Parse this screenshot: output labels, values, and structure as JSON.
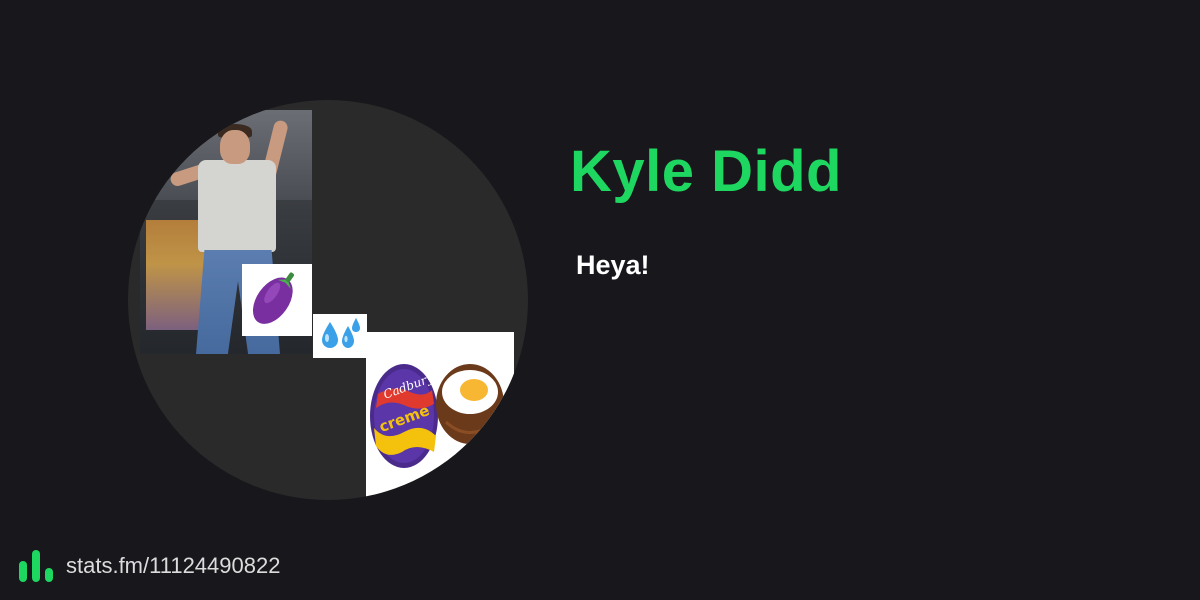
{
  "profile": {
    "display_name": "Kyle Didd",
    "bio": "Heya!",
    "avatar": {
      "tiles": [
        "photo",
        "eggplant-emoji",
        "sweat-droplets-emoji",
        "creme-egg"
      ],
      "egg_brand_text": "Cadbury creme egg"
    }
  },
  "footer": {
    "logo_icon": "stats-bars-icon",
    "link_text": "stats.fm/11124490822"
  },
  "colors": {
    "background": "#18171c",
    "accent": "#1ed760",
    "avatar_background": "#2a2a2a",
    "text": "#ffffff"
  }
}
